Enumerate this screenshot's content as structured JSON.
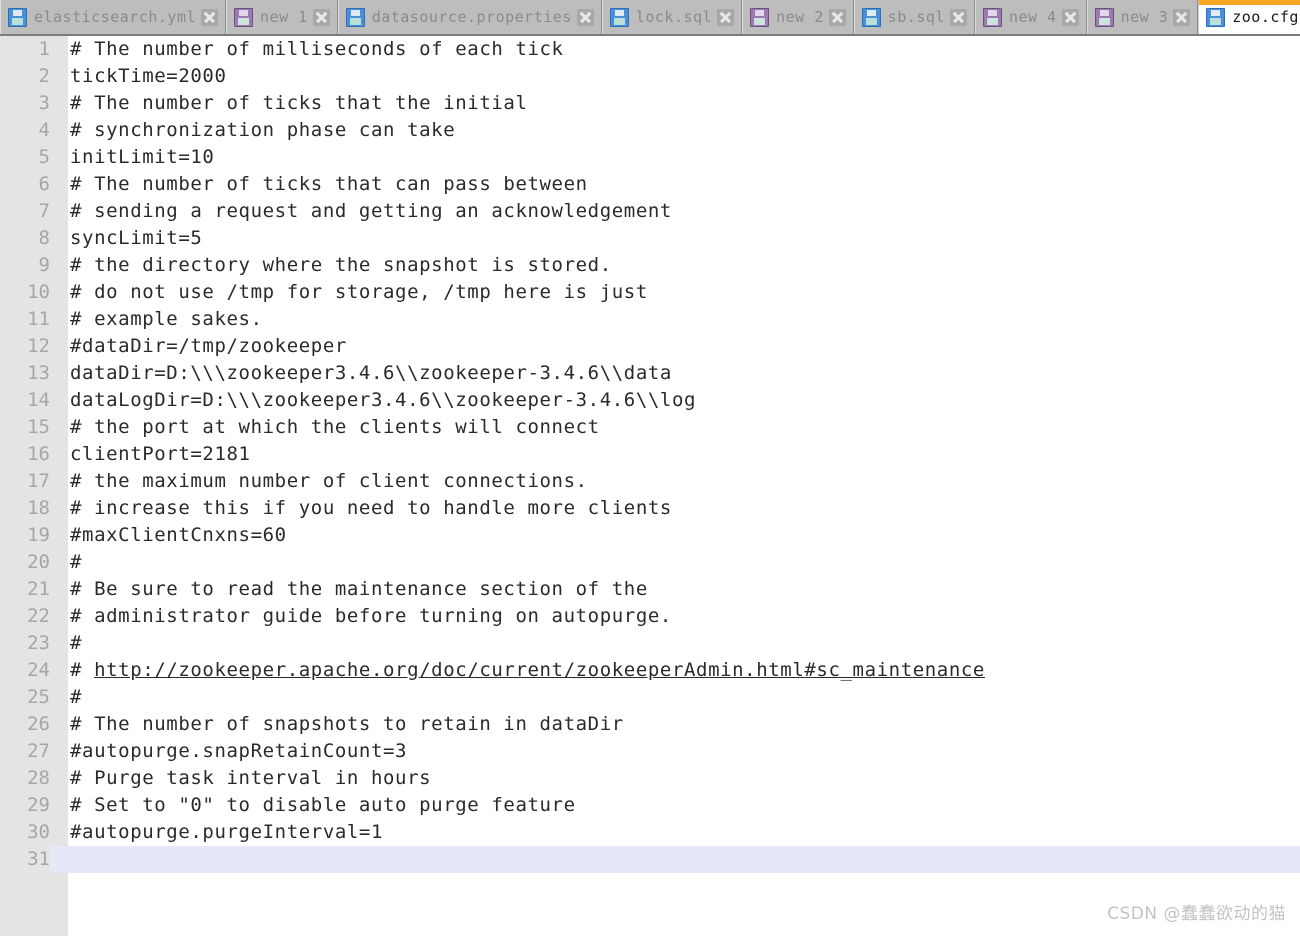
{
  "window": {
    "active_document": "zoo.cfg"
  },
  "tabbar": {
    "accent_color": "#f5a623",
    "active_close_color": "#b06878",
    "tabs": [
      {
        "label": "elasticsearch.yml",
        "icon": "floppy-disk-icon",
        "icon_color": "#4a90d9",
        "active": false,
        "close_label": "x"
      },
      {
        "label": "new 1",
        "icon": "floppy-disk-icon",
        "icon_color": "#9b7ab0",
        "active": false,
        "close_label": "x"
      },
      {
        "label": "datasource.properties",
        "icon": "floppy-disk-icon",
        "icon_color": "#4a90d9",
        "active": false,
        "close_label": "x"
      },
      {
        "label": "lock.sql",
        "icon": "floppy-disk-icon",
        "icon_color": "#4a90d9",
        "active": false,
        "close_label": "x"
      },
      {
        "label": "new 2",
        "icon": "floppy-disk-icon",
        "icon_color": "#9b7ab0",
        "active": false,
        "close_label": "x"
      },
      {
        "label": "sb.sql",
        "icon": "floppy-disk-icon",
        "icon_color": "#4a90d9",
        "active": false,
        "close_label": "x"
      },
      {
        "label": "new 4",
        "icon": "floppy-disk-icon",
        "icon_color": "#9b7ab0",
        "active": false,
        "close_label": "x"
      },
      {
        "label": "new 3",
        "icon": "floppy-disk-icon",
        "icon_color": "#9b7ab0",
        "active": false,
        "close_label": "x"
      },
      {
        "label": "zoo.cfg",
        "icon": "floppy-disk-icon",
        "icon_color": "#4a90d9",
        "active": true,
        "close_label": "x"
      },
      {
        "label": "",
        "icon": "floppy-disk-icon",
        "icon_color": "#4a90d9",
        "active": false,
        "partial": true,
        "close_label": ""
      }
    ]
  },
  "editor": {
    "total_lines": 31,
    "current_line": 31,
    "current_line_highlight": "#e7e7fa",
    "gutter_background": "#e4e4e4",
    "line_number_color": "#a6a6a6",
    "text_color": "#2a2a2a",
    "lines": [
      {
        "n": "1",
        "text": "# The number of milliseconds of each tick"
      },
      {
        "n": "2",
        "text": "tickTime=2000"
      },
      {
        "n": "3",
        "text": "# The number of ticks that the initial"
      },
      {
        "n": "4",
        "text": "# synchronization phase can take"
      },
      {
        "n": "5",
        "text": "initLimit=10"
      },
      {
        "n": "6",
        "text": "# The number of ticks that can pass between"
      },
      {
        "n": "7",
        "text": "# sending a request and getting an acknowledgement"
      },
      {
        "n": "8",
        "text": "syncLimit=5"
      },
      {
        "n": "9",
        "text": "# the directory where the snapshot is stored."
      },
      {
        "n": "10",
        "text": "# do not use /tmp for storage, /tmp here is just"
      },
      {
        "n": "11",
        "text": "# example sakes."
      },
      {
        "n": "12",
        "text": "#dataDir=/tmp/zookeeper"
      },
      {
        "n": "13",
        "text": "dataDir=D:\\\\\\zookeeper3.4.6\\\\zookeeper-3.4.6\\\\data"
      },
      {
        "n": "14",
        "text": "dataLogDir=D:\\\\\\zookeeper3.4.6\\\\zookeeper-3.4.6\\\\log"
      },
      {
        "n": "15",
        "text": "# the port at which the clients will connect"
      },
      {
        "n": "16",
        "text": "clientPort=2181"
      },
      {
        "n": "17",
        "text": "# the maximum number of client connections."
      },
      {
        "n": "18",
        "text": "# increase this if you need to handle more clients"
      },
      {
        "n": "19",
        "text": "#maxClientCnxns=60"
      },
      {
        "n": "20",
        "text": "#"
      },
      {
        "n": "21",
        "text": "# Be sure to read the maintenance section of the"
      },
      {
        "n": "22",
        "text": "# administrator guide before turning on autopurge."
      },
      {
        "n": "23",
        "text": "#"
      },
      {
        "n": "24",
        "text": "# http://zookeeper.apache.org/doc/current/zookeeperAdmin.html#sc_maintenance",
        "link_from": 2
      },
      {
        "n": "25",
        "text": "#"
      },
      {
        "n": "26",
        "text": "# The number of snapshots to retain in dataDir"
      },
      {
        "n": "27",
        "text": "#autopurge.snapRetainCount=3"
      },
      {
        "n": "28",
        "text": "# Purge task interval in hours"
      },
      {
        "n": "29",
        "text": "# Set to \"0\" to disable auto purge feature"
      },
      {
        "n": "30",
        "text": "#autopurge.purgeInterval=1"
      },
      {
        "n": "31",
        "text": "",
        "current": true
      }
    ]
  },
  "watermark": {
    "text": "CSDN @蠢蠢欲动的猫"
  }
}
